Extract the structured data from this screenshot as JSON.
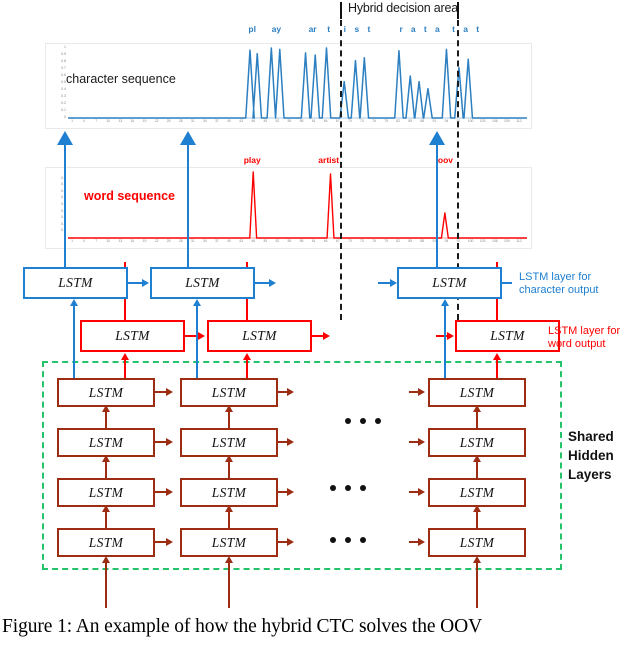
{
  "figure": {
    "caption": "Figure 1: An example of how the hybrid CTC solves the OOV",
    "hybrid_decision_label": "Hybrid decision area"
  },
  "colors": {
    "character_blue": "#1f7fd0",
    "word_red": "#ff0000",
    "shared_brown": "#9c2d12",
    "shared_box_green": "#24c36a",
    "axis_gray": "#8a8a8a",
    "decision_black": "#1a1a1a"
  },
  "labels": {
    "character_sequence": "character sequence",
    "word_sequence": "word sequence",
    "lstm_char_line1": "LSTM  layer for",
    "lstm_char_line2": "character output",
    "lstm_word_line1": "LSTM  layer for",
    "lstm_word_line2": "word output",
    "shared_line1": "Shared",
    "shared_line2": "Hidden",
    "shared_line3": "Layers",
    "lstm_box": "LSTM"
  },
  "chart_data": [
    {
      "id": "character-sequence-chart",
      "type": "line",
      "title": "character sequence",
      "xlabel": "",
      "ylabel": "",
      "ylim": [
        0,
        1
      ],
      "grid": false,
      "legend": "none",
      "series_color": "#2c7fc0",
      "yticks": [
        0,
        0.1,
        0.2,
        0.3,
        0.4,
        0.5,
        0.6,
        0.7,
        0.8,
        0.9,
        1
      ],
      "xticks": [
        1,
        4,
        7,
        10,
        13,
        16,
        19,
        22,
        25,
        28,
        31,
        34,
        37,
        40,
        43,
        46,
        49,
        52,
        55,
        58,
        61,
        64,
        67,
        70,
        73,
        76,
        79,
        82,
        85,
        88,
        91,
        94,
        97,
        100,
        103,
        106,
        109,
        112
      ],
      "annotations": [
        {
          "text": "pl",
          "x": 46
        },
        {
          "text": "ay",
          "x": 52
        },
        {
          "text": "ar",
          "x": 61
        },
        {
          "text": "t",
          "x": 65
        },
        {
          "text": "i",
          "x": 69
        },
        {
          "text": "s",
          "x": 72
        },
        {
          "text": "t",
          "x": 75
        },
        {
          "text": "r",
          "x": 83
        },
        {
          "text": "a",
          "x": 86
        },
        {
          "text": "t",
          "x": 89
        },
        {
          "text": "a",
          "x": 92
        },
        {
          "text": "t",
          "x": 96
        },
        {
          "text": "a",
          "x": 99
        },
        {
          "text": "t",
          "x": 102
        }
      ],
      "peaks": [
        {
          "x": 45.2,
          "y": 0.97
        },
        {
          "x": 47.0,
          "y": 0.92
        },
        {
          "x": 50.5,
          "y": 1.0
        },
        {
          "x": 52.6,
          "y": 0.98
        },
        {
          "x": 59.0,
          "y": 0.93
        },
        {
          "x": 61.4,
          "y": 0.9
        },
        {
          "x": 64.2,
          "y": 1.0
        },
        {
          "x": 68.6,
          "y": 0.52
        },
        {
          "x": 71.4,
          "y": 0.82
        },
        {
          "x": 73.6,
          "y": 0.86
        },
        {
          "x": 82.2,
          "y": 0.96
        },
        {
          "x": 85.0,
          "y": 0.6
        },
        {
          "x": 87.2,
          "y": 0.52
        },
        {
          "x": 89.4,
          "y": 0.42
        },
        {
          "x": 94.0,
          "y": 0.98
        },
        {
          "x": 97.1,
          "y": 0.72
        },
        {
          "x": 99.4,
          "y": 0.84
        }
      ]
    },
    {
      "id": "word-sequence-chart",
      "type": "line",
      "title": "word sequence",
      "xlabel": "",
      "ylabel": "",
      "ylim": [
        0,
        1
      ],
      "grid": false,
      "legend": "none",
      "series_color": "#ff0000",
      "yticks": [
        0,
        0.1,
        0.2,
        0.3,
        0.4,
        0.5,
        0.6,
        0.7,
        0.8,
        0.9,
        1
      ],
      "xticks": [
        1,
        4,
        7,
        10,
        13,
        16,
        19,
        22,
        25,
        28,
        31,
        34,
        37,
        40,
        43,
        46,
        49,
        52,
        55,
        58,
        61,
        64,
        67,
        70,
        73,
        76,
        79,
        82,
        85,
        88,
        91,
        94,
        97,
        100,
        103,
        106,
        109,
        112
      ],
      "annotations": [
        {
          "text": "play",
          "x": 46
        },
        {
          "text": "artist",
          "x": 65
        },
        {
          "text": "oov",
          "x": 94
        }
      ],
      "peaks": [
        {
          "x": 46.0,
          "y": 1.0
        },
        {
          "x": 65.2,
          "y": 0.97
        },
        {
          "x": 93.6,
          "y": 0.38
        }
      ]
    }
  ],
  "decision_lines": {
    "left_x": 70,
    "right_x": 97
  },
  "network": {
    "char_layer_boxes": [
      "LSTM",
      "LSTM",
      "LSTM"
    ],
    "word_layer_boxes": [
      "LSTM",
      "LSTM",
      "LSTM"
    ],
    "shared_layer_rows": [
      [
        "LSTM",
        "LSTM",
        "LSTM"
      ],
      [
        "LSTM",
        "LSTM",
        "LSTM"
      ],
      [
        "LSTM",
        "LSTM",
        "LSTM"
      ],
      [
        "LSTM",
        "LSTM",
        "LSTM"
      ]
    ],
    "ellipsis_count": 3
  }
}
